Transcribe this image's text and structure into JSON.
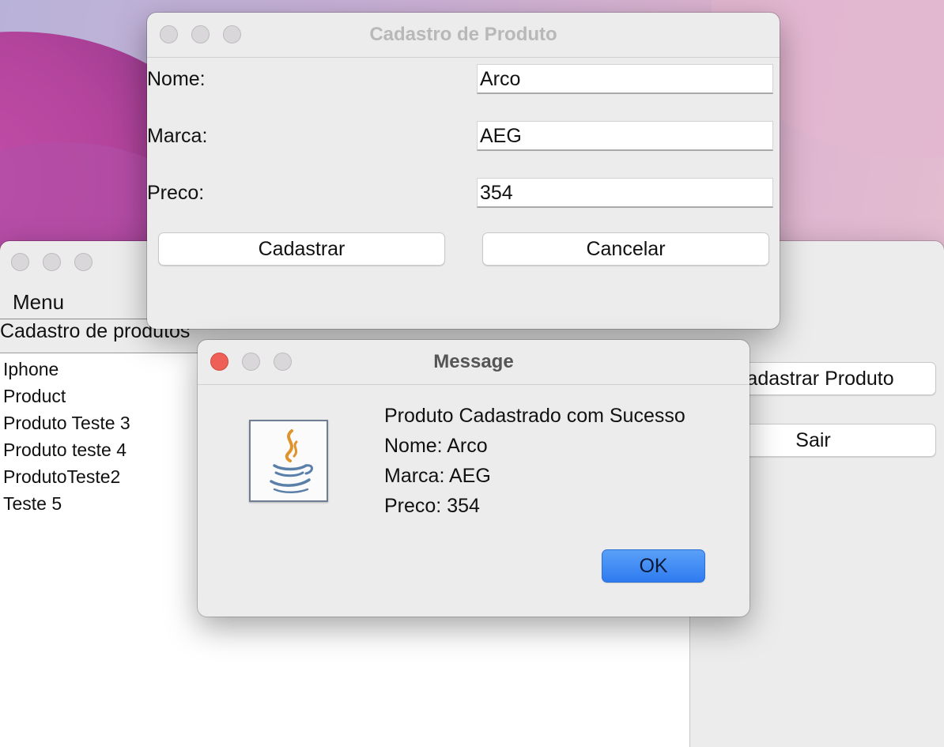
{
  "main_window": {
    "menu": {
      "label": "Menu"
    },
    "list_title": "Cadastro de produtos",
    "products": [
      "Iphone",
      "Product",
      "Produto Teste 3",
      "Produto teste 4",
      "ProdutoTeste2",
      "Teste 5"
    ],
    "buttons": {
      "cadastrar_produto": "Cadastrar Produto",
      "sair": "Sair"
    }
  },
  "form_window": {
    "title": "Cadastro de Produto",
    "fields": [
      {
        "label": "Nome:",
        "value": "Arco"
      },
      {
        "label": "Marca:",
        "value": "AEG"
      },
      {
        "label": "Preco:",
        "value": "354"
      }
    ],
    "buttons": {
      "cadastrar": "Cadastrar",
      "cancelar": "Cancelar"
    }
  },
  "message_dialog": {
    "title": "Message",
    "icon": "java-icon",
    "lines": [
      "Produto Cadastrado com Sucesso",
      "Nome: Arco",
      "Marca: AEG",
      "Preco: 354"
    ],
    "ok_label": "OK"
  }
}
